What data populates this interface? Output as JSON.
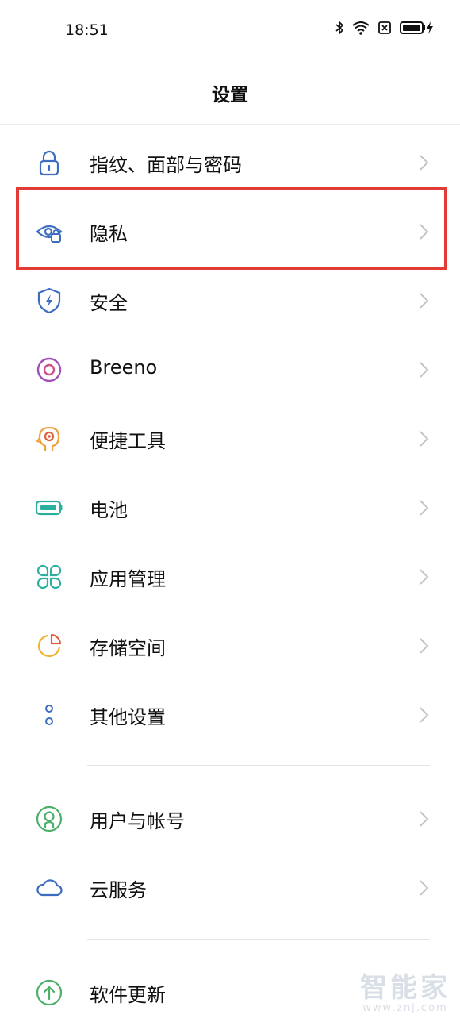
{
  "status_bar": {
    "time": "18:51"
  },
  "header": {
    "title": "设置"
  },
  "settings": {
    "fingerprint": {
      "label": "指纹、面部与密码",
      "icon": "lock-icon"
    },
    "privacy": {
      "label": "隐私",
      "icon": "eye-lock-icon"
    },
    "security": {
      "label": "安全",
      "icon": "shield-bolt-icon"
    },
    "breeno": {
      "label": "Breeno",
      "icon": "breeno-ring-icon"
    },
    "shortcuts": {
      "label": "便捷工具",
      "icon": "head-target-icon"
    },
    "battery": {
      "label": "电池",
      "icon": "battery-icon"
    },
    "apps": {
      "label": "应用管理",
      "icon": "four-petal-icon"
    },
    "storage": {
      "label": "存储空间",
      "icon": "pie-chart-icon"
    },
    "other": {
      "label": "其他设置",
      "icon": "two-dots-icon"
    },
    "accounts": {
      "label": "用户与帐号",
      "icon": "user-circle-icon"
    },
    "cloud": {
      "label": "云服务",
      "icon": "cloud-icon"
    },
    "update": {
      "label": "软件更新",
      "icon": "arrow-up-circle-icon"
    }
  },
  "watermark": {
    "brand": "智能家",
    "url": "www.znj.com"
  },
  "colors": {
    "highlight": "#e23b35",
    "blue": "#3d6cc0",
    "purple": "#a050b8",
    "orange": "#f0a040",
    "teal": "#2bb0a0",
    "yellow": "#f2b233",
    "green": "#4caf6a"
  }
}
